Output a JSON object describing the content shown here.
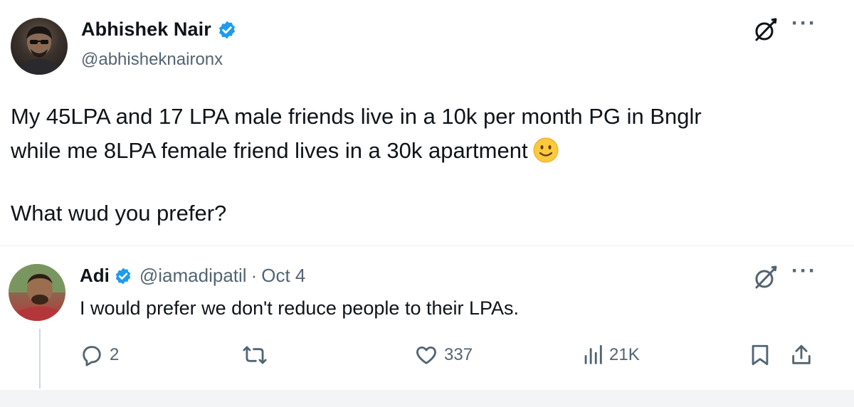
{
  "main_tweet": {
    "author_name": "Abhishek Nair",
    "author_handle": "@abhisheknaironx",
    "text_line1": "My 45LPA and 17 LPA male friends live in a 10k per month PG in Bnglr",
    "text_line2": "while me 8LPA female friend lives in a 30k apartment",
    "text_line3": "What wud you prefer?",
    "emoji": "slightly-smiling-face"
  },
  "reply": {
    "author_name": "Adi",
    "author_handle": "@iamadipatil",
    "separator": "·",
    "date": "Oct 4",
    "text": "I would prefer we don't reduce people to their LPAs."
  },
  "actions": {
    "reply_count": "2",
    "like_count": "337",
    "view_count": "21K"
  },
  "icons": {
    "verified": "verified-badge-icon",
    "grok": "grok-icon",
    "more": "more-icon",
    "reply": "reply-icon",
    "retweet": "retweet-icon",
    "like": "heart-icon",
    "views": "views-chart-icon",
    "bookmark": "bookmark-icon",
    "share": "share-icon"
  },
  "colors": {
    "text": "#0f1419",
    "secondary": "#536471",
    "verified_blue": "#1d9bf0",
    "background": "#ffffff"
  }
}
